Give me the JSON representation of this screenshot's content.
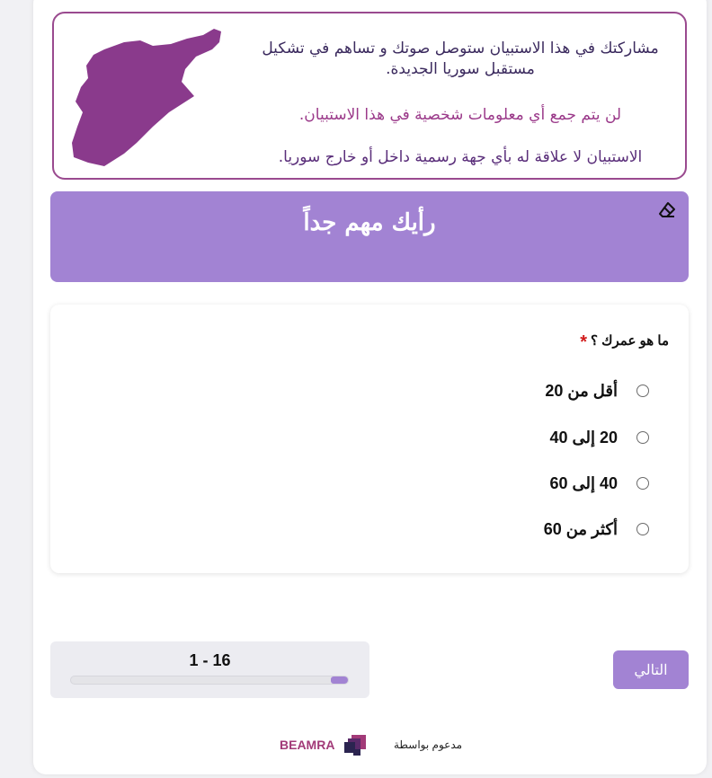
{
  "intro": {
    "line1": "مشاركتك في هذا الاستبيان ستوصل صوتك و تساهم في تشكيل مستقبل سوريا الجديدة.",
    "line2": "لن يتم جمع أي معلومات شخصية في هذا الاستبيان.",
    "line3": "الاستبيان لا علاقة له بأي جهة رسمية داخل أو خارج سوريا.",
    "map_icon": "syria-map-icon",
    "map_color": "#8a3a8c",
    "border_color": "#9a4a8f"
  },
  "banner": {
    "title": "رأيك مهم جداً",
    "eraser_icon": "eraser-icon",
    "color": "#a283d3"
  },
  "question": {
    "label": "ما هو عمرك ؟",
    "required_mark": "*",
    "options": [
      {
        "label": "أقل من 20",
        "selected": false
      },
      {
        "label": "20 إلى 40",
        "selected": false
      },
      {
        "label": "40 إلى 60",
        "selected": false
      },
      {
        "label": "أكثر من 60",
        "selected": false
      }
    ]
  },
  "progress": {
    "label": "1 - 16",
    "fraction": 0.0625
  },
  "navigation": {
    "next_label": "التالي"
  },
  "footer": {
    "powered_by": "مدعوم بواسطة",
    "brand": "BEAMRA",
    "brand_color": "#a23a78"
  }
}
